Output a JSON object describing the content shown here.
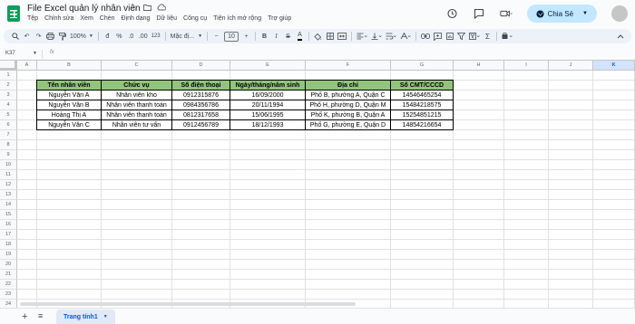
{
  "window": {
    "title": "File Excel quản lý nhân viên",
    "title_icons": [
      "star-icon",
      "folder-move-icon",
      "cloud-status-icon"
    ]
  },
  "menu": [
    "Tệp",
    "Chỉnh sửa",
    "Xem",
    "Chèn",
    "Định dạng",
    "Dữ liệu",
    "Công cụ",
    "Tiện ích mở rộng",
    "Trợ giúp"
  ],
  "top_right": {
    "share_label": "Chia Sẻ"
  },
  "toolbar": {
    "zoom": "100%",
    "currency": "đ",
    "percent": "%",
    "decrease_decimal": ".0",
    "increase_decimal": ".00",
    "number_format": "123",
    "font_family": "Mặc đị...",
    "font_size": "10",
    "bold": "B",
    "italic": "I",
    "strike": "S",
    "text_color": "A"
  },
  "formula_bar": {
    "cell_ref": "K37",
    "fx": "fx",
    "value": ""
  },
  "grid": {
    "columns": [
      "A",
      "B",
      "C",
      "D",
      "E",
      "F",
      "G",
      "H",
      "I",
      "J",
      "K"
    ],
    "selected_column": "K",
    "rows": [
      "1",
      "2",
      "3",
      "4",
      "5",
      "6",
      "7",
      "8",
      "9",
      "10",
      "11",
      "12",
      "13",
      "14",
      "15",
      "16",
      "17",
      "18",
      "19",
      "20",
      "21",
      "22",
      "23",
      "24",
      "25"
    ]
  },
  "table": {
    "headers": [
      "Tên nhân viên",
      "Chức vụ",
      "Số điện thoại",
      "Ngày/tháng/năm sinh",
      "Địa chỉ",
      "Số CMT/CCCD"
    ],
    "header_color": "#93c47d",
    "rows": [
      [
        "Nguyễn Văn A",
        "Nhân viên kho",
        "0912315876",
        "16/09/2000",
        "Phố B, phường A, Quận C",
        "14546465254"
      ],
      [
        "Nguyễn Văn B",
        "Nhân viên thanh toán",
        "0984356786",
        "20/11/1994",
        "Phố H, phường D, Quận M",
        "15484218575"
      ],
      [
        "Hoàng Thị A",
        "Nhân viên thanh toán",
        "0812317658",
        "15/06/1995",
        "Phố K, phường B, Quận A",
        "15254851215"
      ],
      [
        "Nguyễn Văn C",
        "Nhân viên tư vấn",
        "0912456789",
        "18/12/1993",
        "Phố G, phường E, Quận D",
        "14854216654"
      ]
    ]
  },
  "sheets": {
    "active": "Trang tính1"
  },
  "colors": {
    "accent": "#0b57d0",
    "share_bg": "#c2e7ff",
    "sheets_green": "#0f9d58"
  }
}
